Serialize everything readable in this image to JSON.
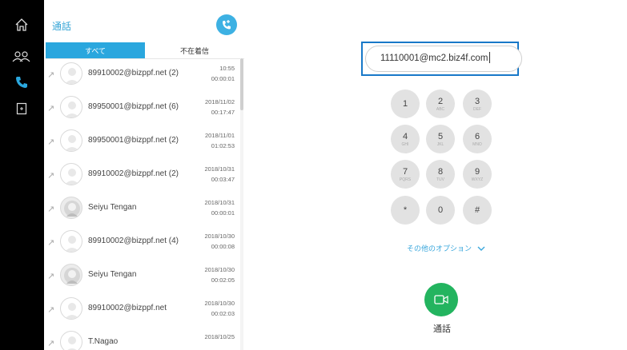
{
  "panel": {
    "title": "通話",
    "tabs": {
      "all": "すべて",
      "missed": "不在着信"
    }
  },
  "calls": [
    {
      "name": "89910002@bizppf.net (2)",
      "date": "10:55",
      "duration": "00:00:01",
      "avatar": "person-silhouette"
    },
    {
      "name": "89950001@bizppf.net (6)",
      "date": "2018/11/02",
      "duration": "00:17:47",
      "avatar": "person-silhouette"
    },
    {
      "name": "89950001@bizppf.net (2)",
      "date": "2018/11/01",
      "duration": "01:02:53",
      "avatar": "person-silhouette"
    },
    {
      "name": "89910002@bizppf.net (2)",
      "date": "2018/10/31",
      "duration": "00:03:47",
      "avatar": "person-silhouette"
    },
    {
      "name": "Seiyu Tengan",
      "date": "2018/10/31",
      "duration": "00:00:01",
      "avatar": "photo"
    },
    {
      "name": "89910002@bizppf.net (4)",
      "date": "2018/10/30",
      "duration": "00:00:08",
      "avatar": "person-silhouette"
    },
    {
      "name": "Seiyu Tengan",
      "date": "2018/10/30",
      "duration": "00:02:05",
      "avatar": "photo"
    },
    {
      "name": "89910002@bizppf.net",
      "date": "2018/10/30",
      "duration": "00:02:03",
      "avatar": "person-silhouette"
    },
    {
      "name": "T.Nagao",
      "date": "2018/10/25",
      "duration": "",
      "avatar": "person-silhouette"
    }
  ],
  "dialer": {
    "number": "11110001@mc2.biz4f.com",
    "keys": [
      {
        "digit": "1",
        "letters": ""
      },
      {
        "digit": "2",
        "letters": "ABC"
      },
      {
        "digit": "3",
        "letters": "DEF"
      },
      {
        "digit": "4",
        "letters": "GHI"
      },
      {
        "digit": "5",
        "letters": "JKL"
      },
      {
        "digit": "6",
        "letters": "MNO"
      },
      {
        "digit": "7",
        "letters": "PQRS"
      },
      {
        "digit": "8",
        "letters": "TUV"
      },
      {
        "digit": "9",
        "letters": "WXYZ"
      },
      {
        "digit": "*",
        "letters": ""
      },
      {
        "digit": "0",
        "letters": ""
      },
      {
        "digit": "#",
        "letters": ""
      }
    ],
    "options_label": "その他のオプション",
    "call_label": "通話"
  },
  "colors": {
    "accent": "#2aa7de",
    "call_green": "#23b45f",
    "focus_border": "#1878c8"
  }
}
